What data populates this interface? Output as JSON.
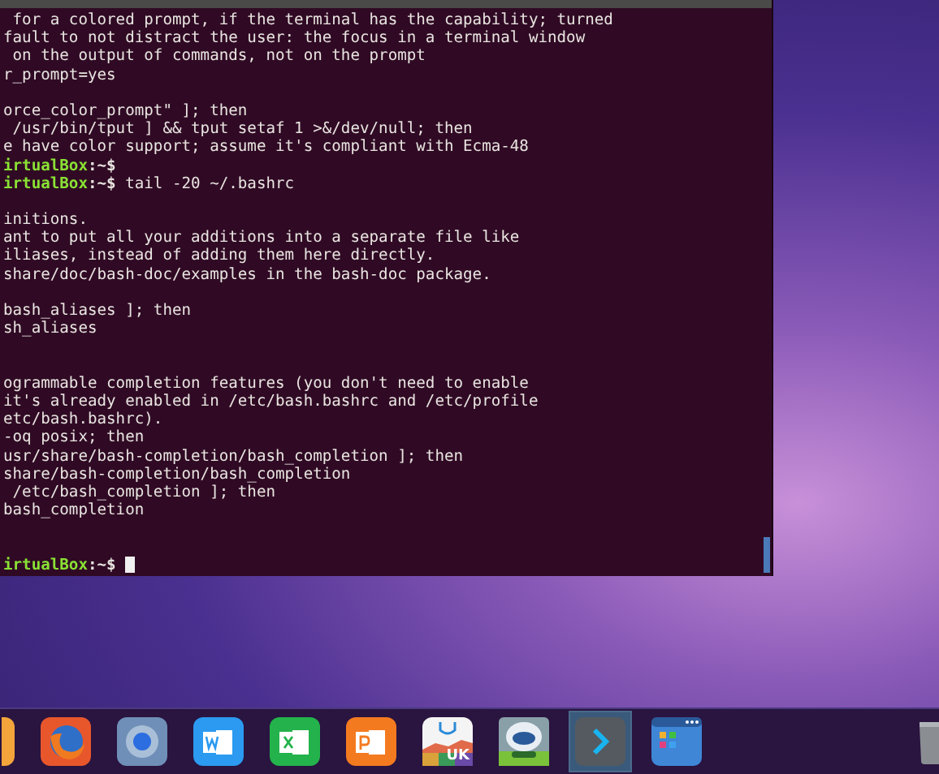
{
  "terminal": {
    "lines": [
      {
        "kind": "output",
        "text": " for a colored prompt, if the terminal has the capability; turned"
      },
      {
        "kind": "output",
        "text": "fault to not distract the user: the focus in a terminal window"
      },
      {
        "kind": "output",
        "text": " on the output of commands, not on the prompt"
      },
      {
        "kind": "output",
        "text": "r_prompt=yes"
      },
      {
        "kind": "blank"
      },
      {
        "kind": "output",
        "text": "orce_color_prompt\" ]; then"
      },
      {
        "kind": "output",
        "text": " /usr/bin/tput ] && tput setaf 1 >&/dev/null; then"
      },
      {
        "kind": "output",
        "text": "e have color support; assume it's compliant with Ecma-48"
      },
      {
        "kind": "prompt",
        "host": "irtualBox",
        "marker": ":~$",
        "cursor": false
      },
      {
        "kind": "prompt",
        "host": "irtualBox",
        "marker": ":~$",
        "command": "tail -20 ~/.bashrc",
        "cursor": false
      },
      {
        "kind": "blank"
      },
      {
        "kind": "output",
        "text": "initions."
      },
      {
        "kind": "output",
        "text": "ant to put all your additions into a separate file like"
      },
      {
        "kind": "output",
        "text": "iliases, instead of adding them here directly."
      },
      {
        "kind": "output",
        "text": "share/doc/bash-doc/examples in the bash-doc package."
      },
      {
        "kind": "blank"
      },
      {
        "kind": "output",
        "text": "bash_aliases ]; then"
      },
      {
        "kind": "output",
        "text": "sh_aliases"
      },
      {
        "kind": "blank"
      },
      {
        "kind": "blank"
      },
      {
        "kind": "output",
        "text": "ogrammable completion features (you don't need to enable"
      },
      {
        "kind": "output",
        "text": "it's already enabled in /etc/bash.bashrc and /etc/profile"
      },
      {
        "kind": "output",
        "text": "etc/bash.bashrc)."
      },
      {
        "kind": "output",
        "text": "-oq posix; then"
      },
      {
        "kind": "output",
        "text": "usr/share/bash-completion/bash_completion ]; then"
      },
      {
        "kind": "output",
        "text": "share/bash-completion/bash_completion"
      },
      {
        "kind": "output",
        "text": " /etc/bash_completion ]; then"
      },
      {
        "kind": "output",
        "text": "bash_completion"
      },
      {
        "kind": "blank"
      },
      {
        "kind": "blank"
      },
      {
        "kind": "prompt",
        "host": "irtualBox",
        "marker": ":~$",
        "cursor": true
      }
    ]
  },
  "dock": {
    "items": [
      {
        "kind": "partial",
        "selected": false
      },
      {
        "kind": "firefox",
        "selected": false
      },
      {
        "kind": "browser",
        "selected": false
      },
      {
        "kind": "word",
        "selected": false
      },
      {
        "kind": "excel",
        "selected": false
      },
      {
        "kind": "powerpoint",
        "selected": false
      },
      {
        "kind": "store",
        "label": "UK",
        "selected": false
      },
      {
        "kind": "robot",
        "selected": false
      },
      {
        "kind": "terminal",
        "selected": true
      },
      {
        "kind": "files",
        "selected": false
      }
    ]
  }
}
